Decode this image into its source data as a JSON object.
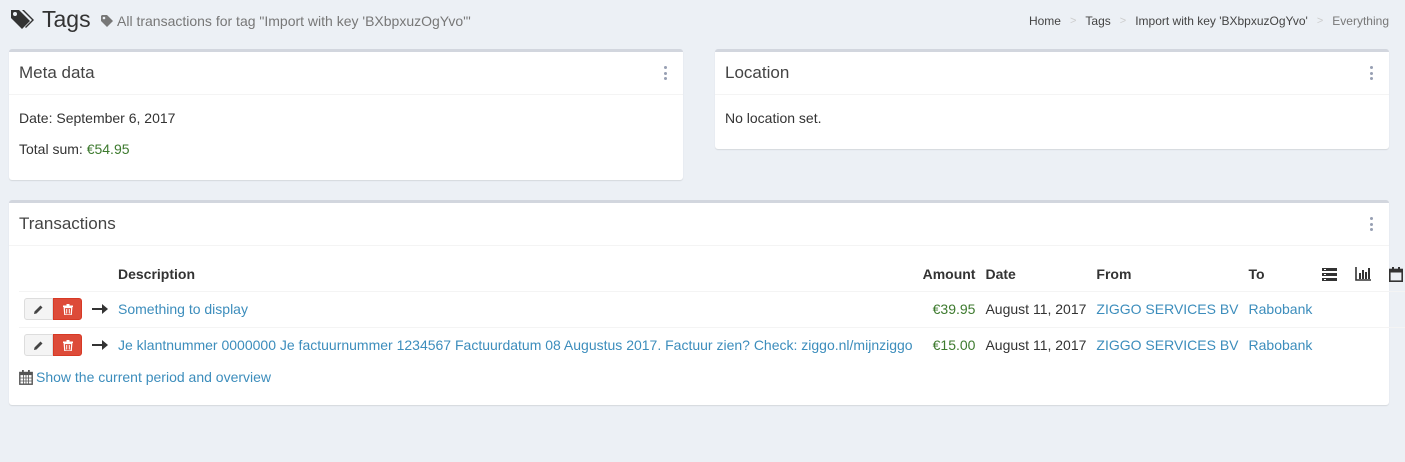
{
  "header": {
    "title": "Tags",
    "subtitle": "All transactions for tag \"Import with key 'BXbpxuzOgYvo'\"",
    "breadcrumbs": [
      "Home",
      "Tags",
      "Import with key 'BXbpxuzOgYvo'",
      "Everything"
    ],
    "breadcrumb_separator": ">"
  },
  "meta_box": {
    "title": "Meta data",
    "date_label": "Date: September 6, 2017",
    "total_label": "Total sum:",
    "total_value": "€54.95"
  },
  "location_box": {
    "title": "Location",
    "text": "No location set."
  },
  "transactions_box": {
    "title": "Transactions",
    "columns": {
      "description": "Description",
      "amount": "Amount",
      "date": "Date",
      "from": "From",
      "to": "To"
    },
    "header_icons": [
      "list-icon",
      "bar-chart-icon",
      "calendar-icon"
    ],
    "rows": [
      {
        "description": "Something to display",
        "amount": "€39.95",
        "date": "August 11, 2017",
        "from": "ZIGGO SERVICES BV",
        "to": "Rabobank"
      },
      {
        "description": "Je klantnummer 0000000 Je factuurnummer 1234567 Factuurdatum 08 Augustus 2017. Factuur zien? Check: ziggo.nl/mijnziggo",
        "amount": "€15.00",
        "date": "August 11, 2017",
        "from": "ZIGGO SERVICES BV",
        "to": "Rabobank"
      }
    ],
    "overview_link": "Show the current period and overview"
  },
  "colors": {
    "background": "#ecf0f5",
    "link": "#3c8dbc",
    "positive_amount": "#3d7a2e",
    "delete_button": "#dd4b39",
    "box_border": "#d2d6de"
  }
}
